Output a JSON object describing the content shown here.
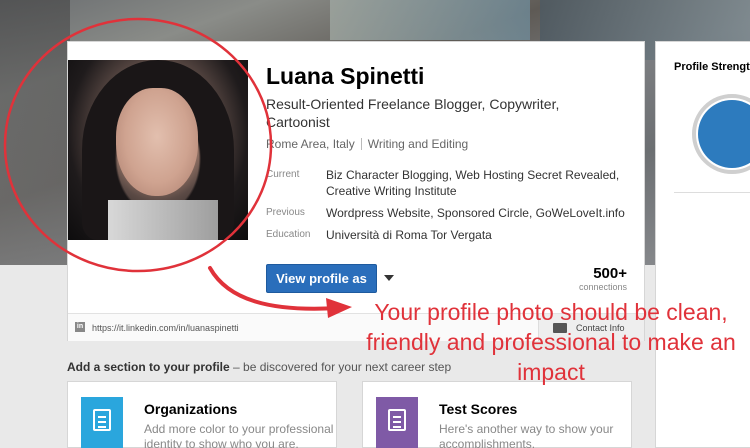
{
  "profile": {
    "name": "Luana Spinetti",
    "headline": "Result-Oriented Freelance Blogger, Copywriter, Cartoonist",
    "location": "Rome Area, Italy",
    "industry": "Writing and Editing",
    "rows": [
      {
        "label": "Current",
        "value": "Biz Character Blogging, Web Hosting Secret Revealed, Creative Writing Institute"
      },
      {
        "label": "Previous",
        "value": "Wordpress Website, Sponsored Circle, GoWeLoveIt.info"
      },
      {
        "label": "Education",
        "value": "Università di Roma Tor Vergata"
      }
    ],
    "view_button": "View profile as",
    "connections_count": "500+",
    "connections_label": "connections",
    "url": "https://it.linkedin.com/in/luanaspinetti",
    "contact_info": "Contact Info",
    "linkedin_badge": "in"
  },
  "sidebar": {
    "title": "Profile Strength"
  },
  "add_section": {
    "bold": "Add a section to your profile",
    "rest": " – be discovered for your next career step"
  },
  "tiles": [
    {
      "title": "Organizations",
      "desc": "Add more color to your professional identity to show who you are.",
      "icon": "organization-icon"
    },
    {
      "title": "Test Scores",
      "desc": "Here's another way to show your accomplishments.",
      "icon": "document-list-icon"
    }
  ],
  "annotation": {
    "text": "Your profile photo should be clean, friendly and professional to make an impact",
    "color": "#e0323a"
  },
  "colors": {
    "primary_button": "#2a6ebb",
    "strength_circle": "#2d7bbe"
  }
}
